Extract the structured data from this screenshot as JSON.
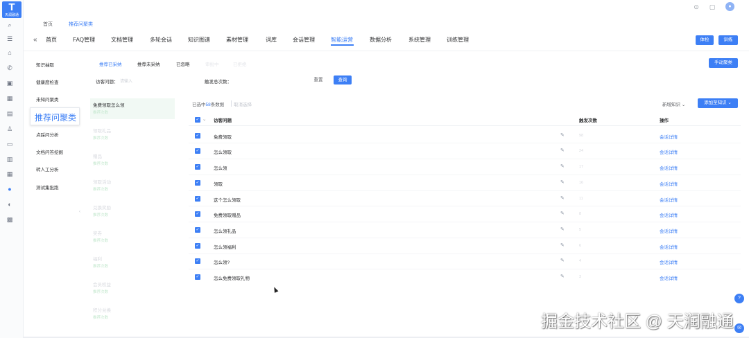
{
  "app": {
    "logo_letter": "T",
    "logo_name": "天润融通"
  },
  "rail_icons": [
    "search-icon",
    "list-icon",
    "home-icon",
    "phone-icon",
    "chat-icon",
    "grid-icon",
    "clipboard-icon",
    "users-icon",
    "inbox-icon",
    "table-icon",
    "apps-icon",
    "robot-icon",
    "bubble-icon",
    "modules-icon"
  ],
  "breadcrumb": {
    "home": "首页",
    "current": "推荐问聚类"
  },
  "nav": {
    "collapse": "«",
    "items": [
      "首页",
      "FAQ管理",
      "文档管理",
      "多轮会话",
      "知识图谱",
      "素材管理",
      "词库",
      "会话管理",
      "智能运营",
      "数据分析",
      "系统管理",
      "训练管理"
    ],
    "active_index": 8
  },
  "header_buttons": {
    "check": "体检",
    "train": "训练"
  },
  "sidebar": {
    "items": [
      "知识抽取",
      "健康度检查",
      "未知问聚类",
      "推荐问聚类",
      "点踩问分析",
      "文档问答挖掘",
      "转人工分析",
      "测试集批跑"
    ],
    "active": "推荐问聚类",
    "collapse_arrow": "‹"
  },
  "subtabs": [
    "推荐已采纳",
    "推荐未采纳",
    "已忽略",
    "审批中",
    "已拒绝"
  ],
  "manual_cluster": "手动聚类",
  "filter": {
    "visitor_label": "访客问题：",
    "visitor_placeholder": "请输入",
    "trigger_label": "触发总次数：",
    "reset": "重置",
    "query": "查询"
  },
  "clusters": [
    {
      "title": "免费领取怎么领",
      "sub": "推荐次数"
    },
    {
      "title": "领取礼品",
      "sub": "推荐次数"
    },
    {
      "title": "赠品",
      "sub": "推荐次数"
    },
    {
      "title": "领取活动",
      "sub": "推荐次数"
    },
    {
      "title": "兑换奖励",
      "sub": "推荐次数"
    },
    {
      "title": "奖券",
      "sub": "推荐次数"
    },
    {
      "title": "福利",
      "sub": "推荐次数"
    },
    {
      "title": "会员权益",
      "sub": "推荐次数"
    },
    {
      "title": "积分兑换",
      "sub": "推荐次数"
    }
  ],
  "table_toolbar": {
    "selected_prefix": "已选中",
    "selected_count": "58",
    "selected_suffix": "条数据",
    "cancel": "取消选择",
    "new_knowledge": "新增知识",
    "add_to_existing": "添加至知识"
  },
  "table": {
    "columns": {
      "question": "访客问题",
      "count": "触发次数",
      "action": "操作"
    },
    "action_label": "会话详情",
    "rows": [
      {
        "question": "免费领取",
        "count": "98"
      },
      {
        "question": "怎么领取",
        "count": "24"
      },
      {
        "question": "怎么领",
        "count": "17"
      },
      {
        "question": "领取",
        "count": "16"
      },
      {
        "question": "这个怎么领取",
        "count": "11"
      },
      {
        "question": "免费领取赠品",
        "count": "8"
      },
      {
        "question": "怎么领礼品",
        "count": "5"
      },
      {
        "question": "怎么领福利",
        "count": "6"
      },
      {
        "question": "怎么领?",
        "count": "4"
      },
      {
        "question": "怎么免费领取礼物",
        "count": "3"
      }
    ]
  },
  "watermark": "掘金技术社区 @ 天润融通",
  "colors": {
    "primary": "#3d7ff5",
    "text": "#303133",
    "muted": "#606266"
  }
}
